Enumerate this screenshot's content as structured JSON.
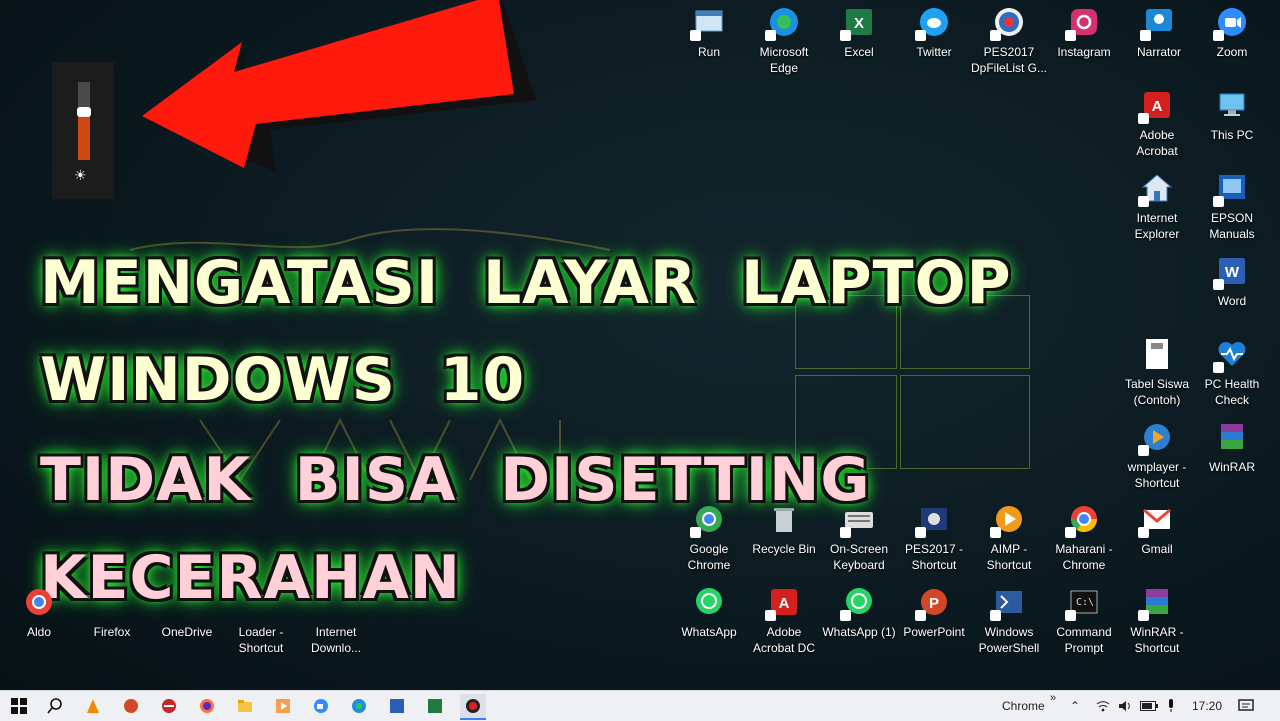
{
  "title": {
    "line1": "MENGATASI  LAYAR  LAPTOP",
    "line2": "WINDOWS  10",
    "line3": "TIDAK  BISA  DISETTING",
    "line4": "KECERAHAN"
  },
  "brightness": {
    "level": 0.62,
    "icon": "sun-icon"
  },
  "desktop_icons": {
    "run": "Run",
    "edge": "Microsoft Edge",
    "excel": "Excel",
    "twitter": "Twitter",
    "pes_list": "PES2017 DpFileList G...",
    "instagram": "Instagram",
    "narrator": "Narrator",
    "zoom": "Zoom",
    "adobe_acrobat": "Adobe Acrobat",
    "this_pc": "This PC",
    "internet_explorer": "Internet Explorer",
    "epson": "EPSON Manuals",
    "word": "Word",
    "tabel_siswa": "Tabel Siswa (Contoh)",
    "pc_health": "PC Health Check",
    "wmplayer": "wmplayer - Shortcut",
    "winrar": "WinRAR",
    "google_chrome": "Google Chrome",
    "recycle_bin": "Recycle Bin",
    "onscreen_keyboard": "On-Screen Keyboard",
    "pes_shortcut": "PES2017 - Shortcut",
    "aimp": "AIMP - Shortcut",
    "maharani": "Maharani - Chrome",
    "gmail": "Gmail",
    "whatsapp": "WhatsApp",
    "acrobat_dc": "Adobe Acrobat DC",
    "whatsapp1": "WhatsApp (1)",
    "powerpoint": "PowerPoint",
    "powershell": "Windows PowerShell",
    "command_prompt": "Command Prompt",
    "winrar_shortcut": "WinRAR - Shortcut",
    "aldo": "Aldo",
    "firefox": "Firefox",
    "onedrive": "OneDrive",
    "loader": "Loader - Shortcut",
    "internet_download": "Internet Downlo..."
  },
  "taskbar": {
    "tray_app": "Chrome",
    "tray_chevron": "»",
    "time": "17:20"
  },
  "colors": {
    "title_yellow": "#fbffd1",
    "title_pink": "#ffd0d8",
    "glow": "#2eff35",
    "arrow": "#ff1a0d",
    "slider_fill": "#cc4a0e",
    "taskbar": "#eef0f4"
  }
}
